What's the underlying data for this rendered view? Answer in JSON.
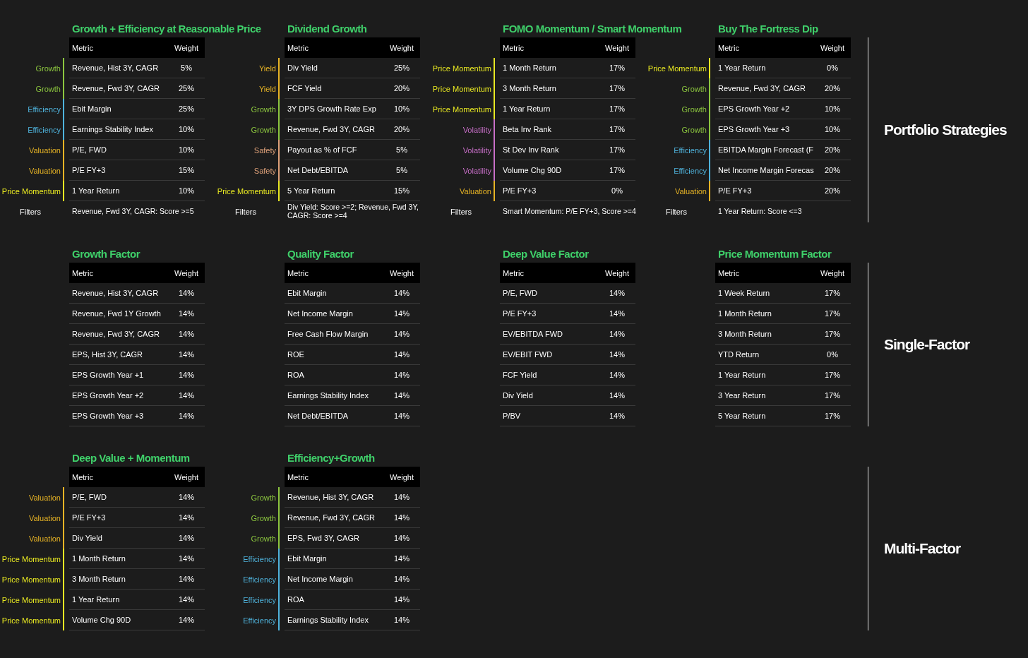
{
  "sections": [
    {
      "title": "Portfolio Strategies",
      "strategies": [
        {
          "title": "Growth + Efficiency at Reasonable Price",
          "columns": [
            "Metric",
            "Weight"
          ],
          "rows": [
            {
              "category": "Growth",
              "color": "#8cc63f",
              "metric": "Revenue, Hist 3Y, CAGR",
              "weight": "5%"
            },
            {
              "category": "Growth",
              "color": "#8cc63f",
              "metric": "Revenue, Fwd 3Y, CAGR",
              "weight": "25%"
            },
            {
              "category": "Efficiency",
              "color": "#4fb3dc",
              "metric": "Ebit Margin",
              "weight": "25%"
            },
            {
              "category": "Efficiency",
              "color": "#4fb3dc",
              "metric": "Earnings Stability Index",
              "weight": "10%"
            },
            {
              "category": "Valuation",
              "color": "#e6b325",
              "metric": "P/E, FWD",
              "weight": "10%"
            },
            {
              "category": "Valuation",
              "color": "#e6b325",
              "metric": "P/E FY+3",
              "weight": "15%"
            },
            {
              "category": "Price Momentum",
              "color": "#e8e822",
              "metric": "1 Year Return",
              "weight": "10%"
            }
          ],
          "filters": {
            "label": "Filters",
            "value": "Revenue, Fwd 3Y, CAGR: Score >=5"
          }
        },
        {
          "title": "Dividend Growth",
          "columns": [
            "Metric",
            "Weight"
          ],
          "rows": [
            {
              "category": "Yield",
              "color": "#e6b325",
              "metric": "Div Yield",
              "weight": "25%"
            },
            {
              "category": "Yield",
              "color": "#e6b325",
              "metric": "FCF Yield",
              "weight": "20%"
            },
            {
              "category": "Growth",
              "color": "#8cc63f",
              "metric": "3Y DPS Growth Rate Exp",
              "weight": "10%"
            },
            {
              "category": "Growth",
              "color": "#8cc63f",
              "metric": "Revenue, Fwd 3Y, CAGR",
              "weight": "20%"
            },
            {
              "category": "Safety",
              "color": "#e0a27a",
              "metric": "Payout as % of FCF",
              "weight": "5%"
            },
            {
              "category": "Safety",
              "color": "#e0a27a",
              "metric": "Net Debt/EBITDA",
              "weight": "5%"
            },
            {
              "category": "Price Momentum",
              "color": "#e8e822",
              "metric": "5 Year Return",
              "weight": "15%"
            }
          ],
          "filters": {
            "label": "Filters",
            "value": "Div Yield: Score >=2; Revenue, Fwd 3Y, CAGR: Score >=4"
          }
        },
        {
          "title": "FOMO Momentum / Smart Momentum",
          "columns": [
            "Metric",
            "Weight"
          ],
          "rows": [
            {
              "category": "Price Momentum",
              "color": "#e8e822",
              "metric": "1 Month Return",
              "weight": "17%"
            },
            {
              "category": "Price Momentum",
              "color": "#e8e822",
              "metric": "3 Month Return",
              "weight": "17%"
            },
            {
              "category": "Price Momentum",
              "color": "#e8e822",
              "metric": "1 Year Return",
              "weight": "17%"
            },
            {
              "category": "Volatility",
              "color": "#c86fc8",
              "metric": "Beta Inv Rank",
              "weight": "17%"
            },
            {
              "category": "Volatility",
              "color": "#c86fc8",
              "metric": "St Dev Inv Rank",
              "weight": "17%"
            },
            {
              "category": "Volatility",
              "color": "#c86fc8",
              "metric": "Volume Chg 90D",
              "weight": "17%"
            },
            {
              "category": "Valuation",
              "color": "#e6b325",
              "metric": "P/E FY+3",
              "weight": "0%"
            }
          ],
          "filters": {
            "label": "Filters",
            "value": "Smart Momentum: P/E FY+3, Score >=4"
          }
        },
        {
          "title": "Buy The Fortress Dip",
          "columns": [
            "Metric",
            "Weight"
          ],
          "rows": [
            {
              "category": "Price Momentum",
              "color": "#e8e822",
              "metric": "1 Year Return",
              "weight": "0%"
            },
            {
              "category": "Growth",
              "color": "#8cc63f",
              "metric": "Revenue, Fwd 3Y, CAGR",
              "weight": "20%"
            },
            {
              "category": "Growth",
              "color": "#8cc63f",
              "metric": "EPS Growth Year +2",
              "weight": "10%"
            },
            {
              "category": "Growth",
              "color": "#8cc63f",
              "metric": "EPS Growth Year +3",
              "weight": "10%"
            },
            {
              "category": "Efficiency",
              "color": "#4fb3dc",
              "metric": "EBITDA Margin Forecast (F",
              "weight": "20%"
            },
            {
              "category": "Efficiency",
              "color": "#4fb3dc",
              "metric": "Net Income Margin Forecas",
              "weight": "20%"
            },
            {
              "category": "Valuation",
              "color": "#e6b325",
              "metric": "P/E FY+3",
              "weight": "20%"
            }
          ],
          "filters": {
            "label": "Filters",
            "value": "1 Year Return: Score <=3"
          }
        }
      ]
    },
    {
      "title": "Single-Factor",
      "strategies": [
        {
          "title": "Growth Factor",
          "columns": [
            "Metric",
            "Weight"
          ],
          "rows": [
            {
              "metric": "Revenue, Hist 3Y, CAGR",
              "weight": "14%"
            },
            {
              "metric": "Revenue, Fwd 1Y Growth",
              "weight": "14%"
            },
            {
              "metric": "Revenue, Fwd 3Y, CAGR",
              "weight": "14%"
            },
            {
              "metric": "EPS, Hist 3Y, CAGR",
              "weight": "14%"
            },
            {
              "metric": "EPS Growth Year +1",
              "weight": "14%"
            },
            {
              "metric": "EPS Growth Year +2",
              "weight": "14%"
            },
            {
              "metric": "EPS Growth Year +3",
              "weight": "14%"
            }
          ]
        },
        {
          "title": "Quality Factor",
          "columns": [
            "Metric",
            "Weight"
          ],
          "rows": [
            {
              "metric": "Ebit Margin",
              "weight": "14%"
            },
            {
              "metric": "Net Income Margin",
              "weight": "14%"
            },
            {
              "metric": "Free Cash Flow Margin",
              "weight": "14%"
            },
            {
              "metric": "ROE",
              "weight": "14%"
            },
            {
              "metric": "ROA",
              "weight": "14%"
            },
            {
              "metric": "Earnings Stability Index",
              "weight": "14%"
            },
            {
              "metric": "Net Debt/EBITDA",
              "weight": "14%"
            }
          ]
        },
        {
          "title": "Deep Value Factor",
          "columns": [
            "Metric",
            "Weight"
          ],
          "rows": [
            {
              "metric": "P/E, FWD",
              "weight": "14%"
            },
            {
              "metric": "P/E FY+3",
              "weight": "14%"
            },
            {
              "metric": "EV/EBITDA FWD",
              "weight": "14%"
            },
            {
              "metric": "EV/EBIT FWD",
              "weight": "14%"
            },
            {
              "metric": "FCF Yield",
              "weight": "14%"
            },
            {
              "metric": "Div Yield",
              "weight": "14%"
            },
            {
              "metric": "P/BV",
              "weight": "14%"
            }
          ]
        },
        {
          "title": "Price Momentum Factor",
          "columns": [
            "Metric",
            "Weight"
          ],
          "rows": [
            {
              "metric": "1 Week Return",
              "weight": "17%"
            },
            {
              "metric": "1 Month Return",
              "weight": "17%"
            },
            {
              "metric": "3 Month Return",
              "weight": "17%"
            },
            {
              "metric": "YTD Return",
              "weight": "0%"
            },
            {
              "metric": "1 Year Return",
              "weight": "17%"
            },
            {
              "metric": "3 Year Return",
              "weight": "17%"
            },
            {
              "metric": "5 Year Return",
              "weight": "17%"
            }
          ]
        }
      ]
    },
    {
      "title": "Multi-Factor",
      "strategies": [
        {
          "title": "Deep Value + Momentum",
          "columns": [
            "Metric",
            "Weight"
          ],
          "rows": [
            {
              "category": "Valuation",
              "color": "#e6b325",
              "metric": "P/E, FWD",
              "weight": "14%"
            },
            {
              "category": "Valuation",
              "color": "#e6b325",
              "metric": "P/E FY+3",
              "weight": "14%"
            },
            {
              "category": "Valuation",
              "color": "#e6b325",
              "metric": "Div Yield",
              "weight": "14%"
            },
            {
              "category": "Price Momentum",
              "color": "#e8e822",
              "metric": "1 Month Return",
              "weight": "14%"
            },
            {
              "category": "Price Momentum",
              "color": "#e8e822",
              "metric": "3 Month Return",
              "weight": "14%"
            },
            {
              "category": "Price Momentum",
              "color": "#e8e822",
              "metric": "1 Year Return",
              "weight": "14%"
            },
            {
              "category": "Price Momentum",
              "color": "#e8e822",
              "metric": "Volume Chg 90D",
              "weight": "14%"
            }
          ]
        },
        {
          "title": "Efficiency+Growth",
          "columns": [
            "Metric",
            "Weight"
          ],
          "rows": [
            {
              "category": "Growth",
              "color": "#8cc63f",
              "metric": "Revenue, Hist 3Y, CAGR",
              "weight": "14%"
            },
            {
              "category": "Growth",
              "color": "#8cc63f",
              "metric": "Revenue, Fwd 3Y, CAGR",
              "weight": "14%"
            },
            {
              "category": "Growth",
              "color": "#8cc63f",
              "metric": "EPS, Fwd 3Y, CAGR",
              "weight": "14%"
            },
            {
              "category": "Efficiency",
              "color": "#4fb3dc",
              "metric": "Ebit Margin",
              "weight": "14%"
            },
            {
              "category": "Efficiency",
              "color": "#4fb3dc",
              "metric": "Net Income Margin",
              "weight": "14%"
            },
            {
              "category": "Efficiency",
              "color": "#4fb3dc",
              "metric": "ROA",
              "weight": "14%"
            },
            {
              "category": "Efficiency",
              "color": "#4fb3dc",
              "metric": "Earnings Stability Index",
              "weight": "14%"
            }
          ]
        }
      ]
    }
  ]
}
